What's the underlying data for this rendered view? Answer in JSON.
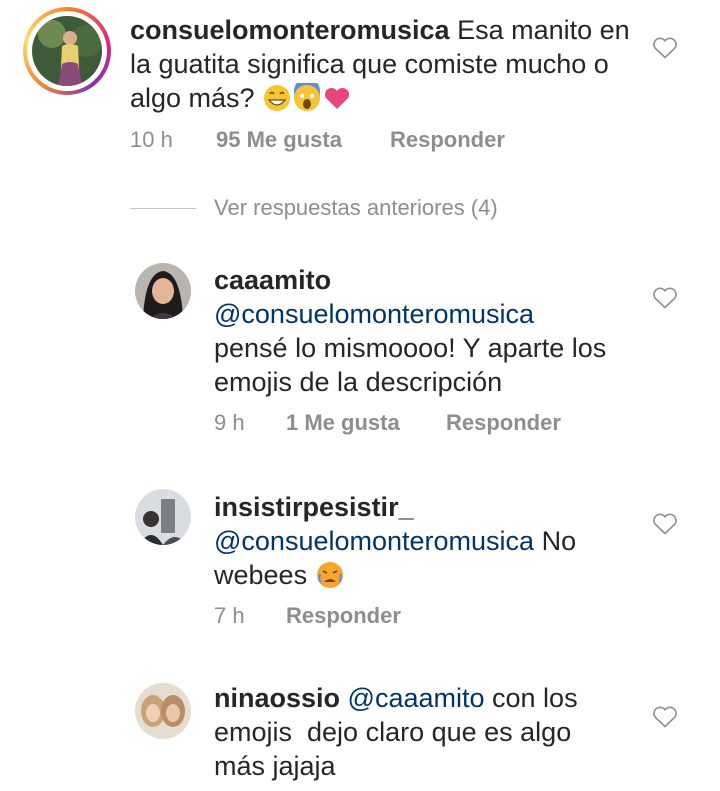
{
  "comments": [
    {
      "username": "consuelomonteromusica",
      "text": " Esa manito en la guatita significa que comiste mucho o algo más?",
      "time": "10 h",
      "likes": "95 Me gusta",
      "reply": "Responder",
      "emojis": [
        "grinning-sweat-emoji",
        "screaming-fear-emoji",
        "pink-heart-emoji"
      ]
    },
    {
      "username": "caaamito",
      "mention": "@consuelomonteromusica",
      "text": "pensé lo mismoooo! Y aparte los emojis de la descripción",
      "time": "9 h",
      "likes": "1 Me gusta",
      "reply": "Responder"
    },
    {
      "username": "insistirpesistir_",
      "mention": "@consuelomonteromusica",
      "text_after_mention": " No",
      "text_line2": "webees",
      "time": "7 h",
      "reply": "Responder",
      "emojis": [
        "crying-angry-emoji"
      ]
    },
    {
      "username": "ninaossio",
      "mention": "@caaamito",
      "text": " con los",
      "text_line2": "emojis  dejo claro que es algo",
      "text_line3": "más jajaja"
    }
  ],
  "view_replies": "Ver respuestas anteriores (4)",
  "colors": {
    "text": "#262626",
    "meta": "#8e8e8e",
    "mention": "#003569",
    "heart_emoji": "#e8457f"
  }
}
